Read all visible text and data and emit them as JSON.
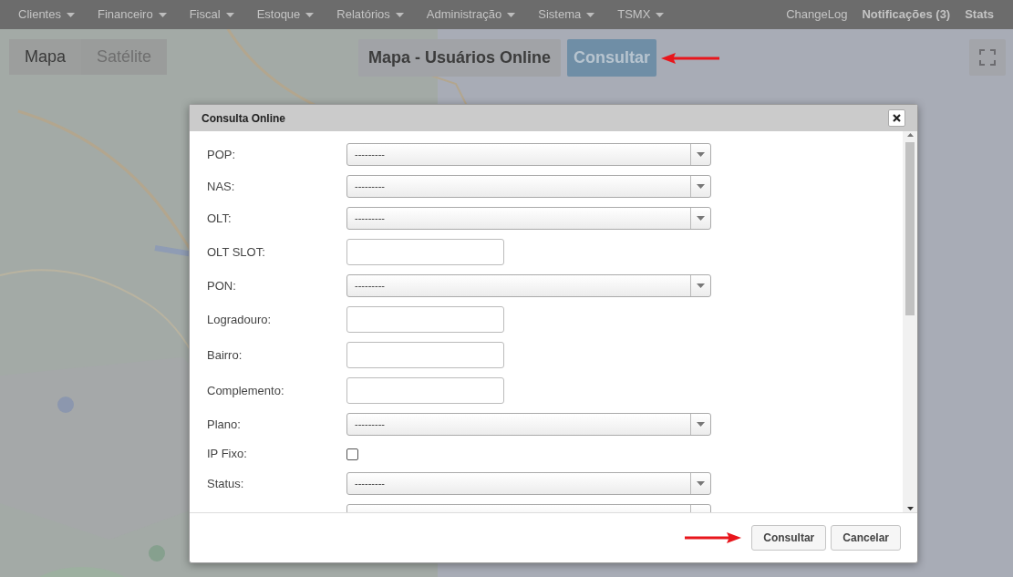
{
  "nav": {
    "menus": [
      {
        "label": "Clientes"
      },
      {
        "label": "Financeiro"
      },
      {
        "label": "Fiscal"
      },
      {
        "label": "Estoque"
      },
      {
        "label": "Relatórios"
      },
      {
        "label": "Administração"
      },
      {
        "label": "Sistema"
      },
      {
        "label": "TSMX"
      }
    ],
    "links": [
      {
        "label": "ChangeLog",
        "bold": false
      },
      {
        "label": "Notificações (3)",
        "bold": true
      },
      {
        "label": "Stats",
        "bold": true
      }
    ]
  },
  "map": {
    "map_types": [
      {
        "label": "Mapa",
        "selected": true
      },
      {
        "label": "Satélite",
        "selected": false
      }
    ],
    "title_button": "Mapa - Usuários Online",
    "consult_button": "Consultar"
  },
  "modal": {
    "title": "Consulta Online",
    "fields": [
      {
        "kind": "select",
        "label": "POP:",
        "value": "---------"
      },
      {
        "kind": "select",
        "label": "NAS:",
        "value": "---------"
      },
      {
        "kind": "select",
        "label": "OLT:",
        "value": "---------"
      },
      {
        "kind": "text",
        "label": "OLT SLOT:"
      },
      {
        "kind": "select",
        "label": "PON:",
        "value": "---------"
      },
      {
        "kind": "text",
        "label": "Logradouro:"
      },
      {
        "kind": "text",
        "label": "Bairro:"
      },
      {
        "kind": "text",
        "label": "Complemento:"
      },
      {
        "kind": "select",
        "label": "Plano:",
        "value": "---------"
      },
      {
        "kind": "checkbox",
        "label": "IP Fixo:",
        "checked": false
      },
      {
        "kind": "select",
        "label": "Status:",
        "value": "---------"
      },
      {
        "kind": "select"
      }
    ],
    "buttons": [
      {
        "label": "Consultar"
      },
      {
        "label": "Cancelar"
      }
    ]
  }
}
